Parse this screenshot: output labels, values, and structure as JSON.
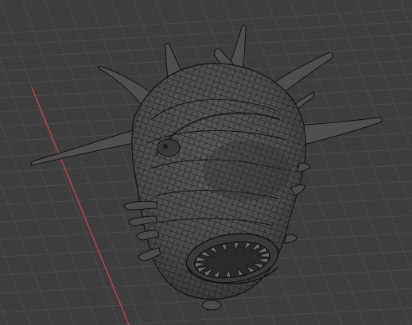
{
  "viewport": {
    "kind": "3d-viewport",
    "shading": "wireframe",
    "object": "creature-head-mesh",
    "colors": {
      "background": "#3d3d3d",
      "grid_line": "#4a4a4a",
      "x_axis": "#c0444f",
      "mesh_fill": "#555555",
      "mesh_shadow": "#3c3c3c",
      "wire": "#141414",
      "mouth_dark": "#2a2a2a"
    }
  }
}
